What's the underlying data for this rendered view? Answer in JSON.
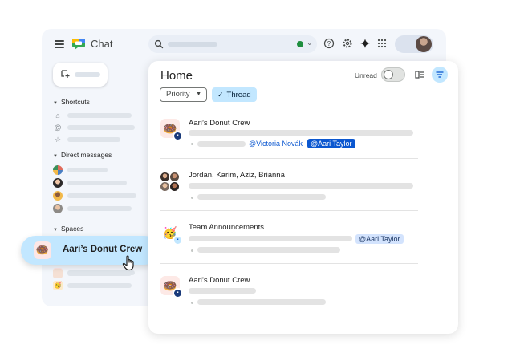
{
  "app": {
    "title": "Chat",
    "colors": {
      "accent": "#0b57d0",
      "selected": "#c2e7ff",
      "status_online": "#1e8e3e"
    }
  },
  "sidebar": {
    "sections": {
      "shortcuts": "Shortcuts",
      "direct_messages": "Direct messages",
      "spaces": "Spaces"
    },
    "selected_space": {
      "label": "Aari’s Donut Crew",
      "icon": "donut-emoji"
    }
  },
  "main": {
    "title": "Home",
    "unread_label": "Unread",
    "unread_on": false,
    "filters": {
      "priority": "Priority",
      "thread": "Thread",
      "thread_selected": true
    },
    "conversations": [
      {
        "name": "Aari’s Donut Crew",
        "icon": "donut-emoji",
        "mention_link": "@Victoria Novák",
        "mention_chip": "@Aari Taylor"
      },
      {
        "name": "Jordan, Karim, Aziz, Brianna",
        "icon": "group-avatars"
      },
      {
        "name": "Team Announcements",
        "icon": "party-emoji",
        "mention_chip": "@Aari Taylor"
      },
      {
        "name": "Aari’s Donut Crew",
        "icon": "donut-emoji"
      }
    ]
  }
}
